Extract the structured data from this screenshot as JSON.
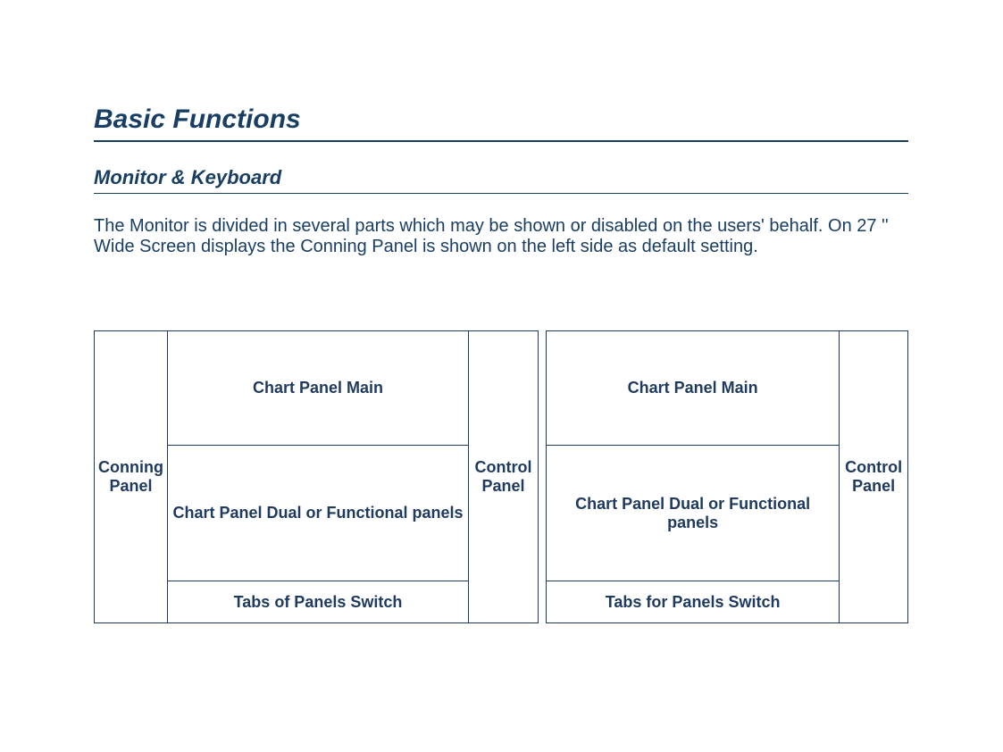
{
  "title": "Basic Functions",
  "subtitle": "Monitor & Keyboard",
  "body": "The Monitor is divided in several parts which may be shown or disabled on the users' behalf. On 27 '' Wide Screen displays the Conning Panel is shown on the left side as default setting.",
  "diagram": {
    "left": {
      "conning": "Conning Panel",
      "chart_main": "Chart Panel Main",
      "chart_dual": "Chart Panel Dual or Functional panels",
      "tabs": "Tabs of Panels Switch",
      "control": "Control Panel"
    },
    "right": {
      "chart_main": "Chart Panel Main",
      "chart_dual": "Chart Panel Dual or Functional panels",
      "tabs": "Tabs for Panels Switch",
      "control": "Control Panel"
    }
  }
}
